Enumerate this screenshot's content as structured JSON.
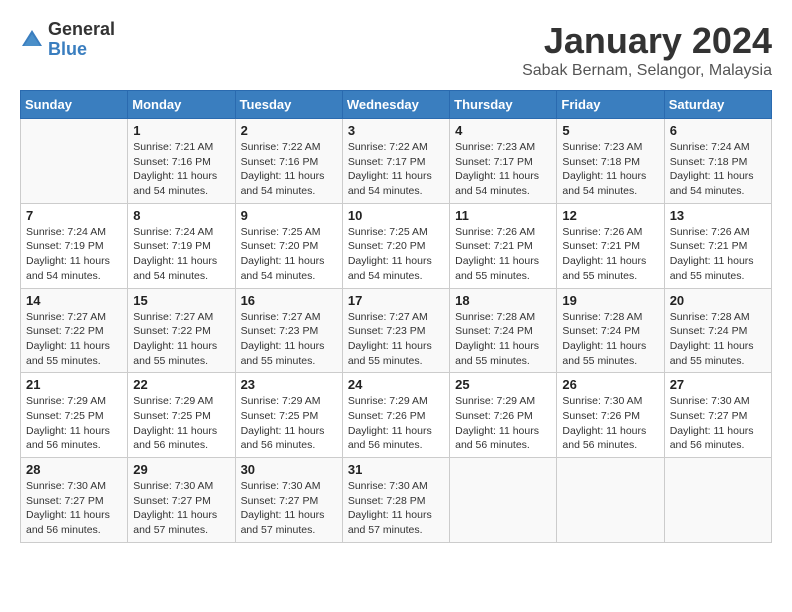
{
  "logo": {
    "general": "General",
    "blue": "Blue"
  },
  "title": "January 2024",
  "subtitle": "Sabak Bernam, Selangor, Malaysia",
  "days_of_week": [
    "Sunday",
    "Monday",
    "Tuesday",
    "Wednesday",
    "Thursday",
    "Friday",
    "Saturday"
  ],
  "weeks": [
    [
      {
        "day": "",
        "info": ""
      },
      {
        "day": "1",
        "info": "Sunrise: 7:21 AM\nSunset: 7:16 PM\nDaylight: 11 hours and 54 minutes."
      },
      {
        "day": "2",
        "info": "Sunrise: 7:22 AM\nSunset: 7:16 PM\nDaylight: 11 hours and 54 minutes."
      },
      {
        "day": "3",
        "info": "Sunrise: 7:22 AM\nSunset: 7:17 PM\nDaylight: 11 hours and 54 minutes."
      },
      {
        "day": "4",
        "info": "Sunrise: 7:23 AM\nSunset: 7:17 PM\nDaylight: 11 hours and 54 minutes."
      },
      {
        "day": "5",
        "info": "Sunrise: 7:23 AM\nSunset: 7:18 PM\nDaylight: 11 hours and 54 minutes."
      },
      {
        "day": "6",
        "info": "Sunrise: 7:24 AM\nSunset: 7:18 PM\nDaylight: 11 hours and 54 minutes."
      }
    ],
    [
      {
        "day": "7",
        "info": "Sunrise: 7:24 AM\nSunset: 7:19 PM\nDaylight: 11 hours and 54 minutes."
      },
      {
        "day": "8",
        "info": "Sunrise: 7:24 AM\nSunset: 7:19 PM\nDaylight: 11 hours and 54 minutes."
      },
      {
        "day": "9",
        "info": "Sunrise: 7:25 AM\nSunset: 7:20 PM\nDaylight: 11 hours and 54 minutes."
      },
      {
        "day": "10",
        "info": "Sunrise: 7:25 AM\nSunset: 7:20 PM\nDaylight: 11 hours and 54 minutes."
      },
      {
        "day": "11",
        "info": "Sunrise: 7:26 AM\nSunset: 7:21 PM\nDaylight: 11 hours and 55 minutes."
      },
      {
        "day": "12",
        "info": "Sunrise: 7:26 AM\nSunset: 7:21 PM\nDaylight: 11 hours and 55 minutes."
      },
      {
        "day": "13",
        "info": "Sunrise: 7:26 AM\nSunset: 7:21 PM\nDaylight: 11 hours and 55 minutes."
      }
    ],
    [
      {
        "day": "14",
        "info": "Sunrise: 7:27 AM\nSunset: 7:22 PM\nDaylight: 11 hours and 55 minutes."
      },
      {
        "day": "15",
        "info": "Sunrise: 7:27 AM\nSunset: 7:22 PM\nDaylight: 11 hours and 55 minutes."
      },
      {
        "day": "16",
        "info": "Sunrise: 7:27 AM\nSunset: 7:23 PM\nDaylight: 11 hours and 55 minutes."
      },
      {
        "day": "17",
        "info": "Sunrise: 7:27 AM\nSunset: 7:23 PM\nDaylight: 11 hours and 55 minutes."
      },
      {
        "day": "18",
        "info": "Sunrise: 7:28 AM\nSunset: 7:24 PM\nDaylight: 11 hours and 55 minutes."
      },
      {
        "day": "19",
        "info": "Sunrise: 7:28 AM\nSunset: 7:24 PM\nDaylight: 11 hours and 55 minutes."
      },
      {
        "day": "20",
        "info": "Sunrise: 7:28 AM\nSunset: 7:24 PM\nDaylight: 11 hours and 55 minutes."
      }
    ],
    [
      {
        "day": "21",
        "info": "Sunrise: 7:29 AM\nSunset: 7:25 PM\nDaylight: 11 hours and 56 minutes."
      },
      {
        "day": "22",
        "info": "Sunrise: 7:29 AM\nSunset: 7:25 PM\nDaylight: 11 hours and 56 minutes."
      },
      {
        "day": "23",
        "info": "Sunrise: 7:29 AM\nSunset: 7:25 PM\nDaylight: 11 hours and 56 minutes."
      },
      {
        "day": "24",
        "info": "Sunrise: 7:29 AM\nSunset: 7:26 PM\nDaylight: 11 hours and 56 minutes."
      },
      {
        "day": "25",
        "info": "Sunrise: 7:29 AM\nSunset: 7:26 PM\nDaylight: 11 hours and 56 minutes."
      },
      {
        "day": "26",
        "info": "Sunrise: 7:30 AM\nSunset: 7:26 PM\nDaylight: 11 hours and 56 minutes."
      },
      {
        "day": "27",
        "info": "Sunrise: 7:30 AM\nSunset: 7:27 PM\nDaylight: 11 hours and 56 minutes."
      }
    ],
    [
      {
        "day": "28",
        "info": "Sunrise: 7:30 AM\nSunset: 7:27 PM\nDaylight: 11 hours and 56 minutes."
      },
      {
        "day": "29",
        "info": "Sunrise: 7:30 AM\nSunset: 7:27 PM\nDaylight: 11 hours and 57 minutes."
      },
      {
        "day": "30",
        "info": "Sunrise: 7:30 AM\nSunset: 7:27 PM\nDaylight: 11 hours and 57 minutes."
      },
      {
        "day": "31",
        "info": "Sunrise: 7:30 AM\nSunset: 7:28 PM\nDaylight: 11 hours and 57 minutes."
      },
      {
        "day": "",
        "info": ""
      },
      {
        "day": "",
        "info": ""
      },
      {
        "day": "",
        "info": ""
      }
    ]
  ]
}
